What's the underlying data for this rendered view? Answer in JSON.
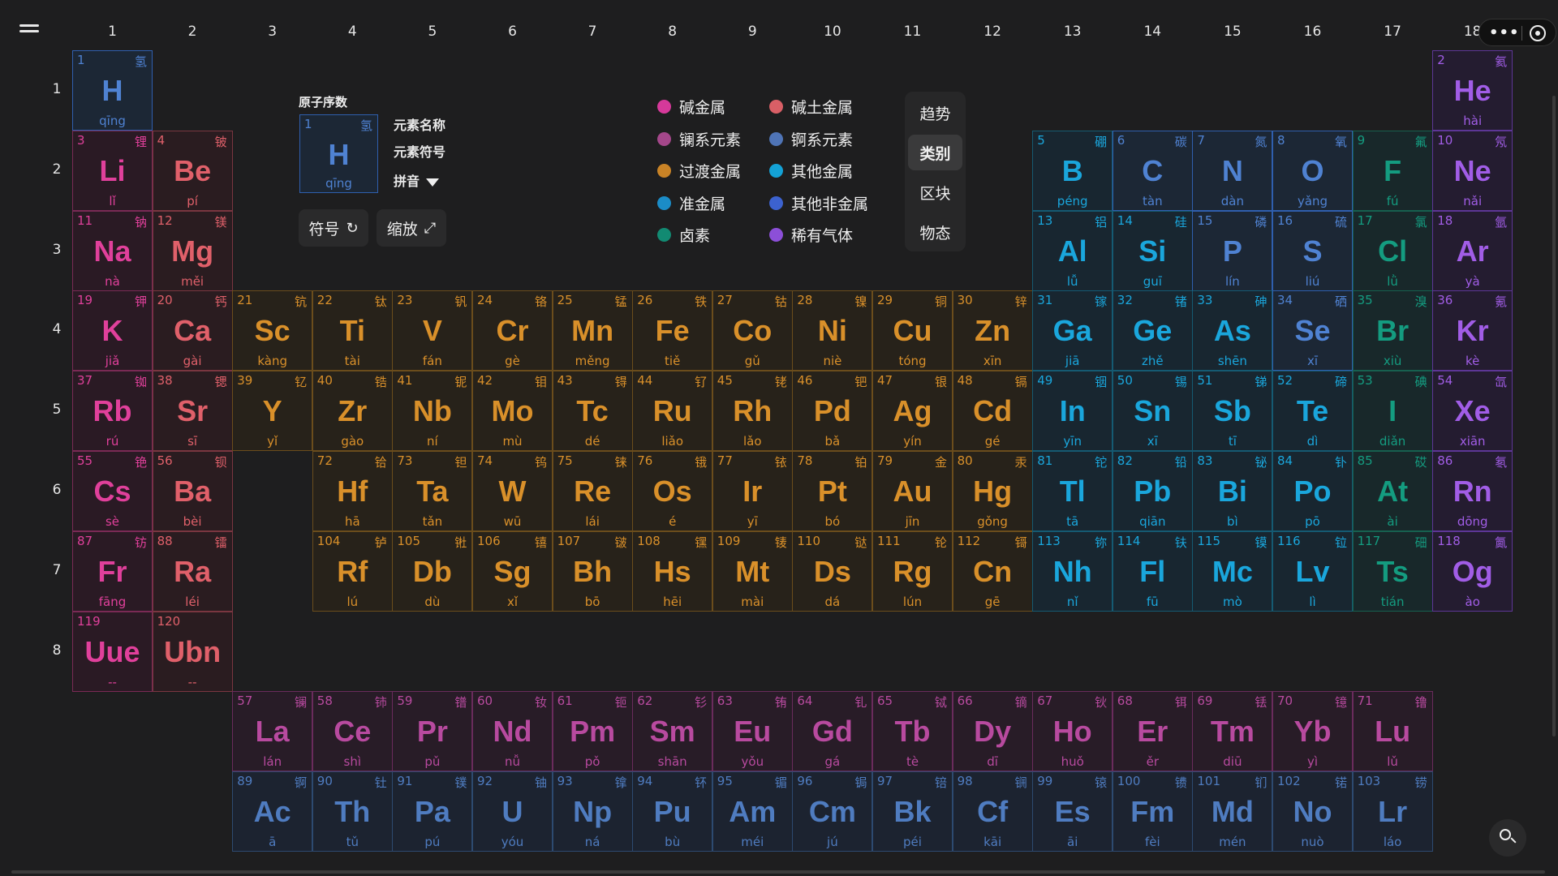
{
  "groups": [
    "1",
    "2",
    "3",
    "4",
    "5",
    "6",
    "7",
    "8",
    "9",
    "10",
    "11",
    "12",
    "13",
    "14",
    "15",
    "16",
    "17",
    "18"
  ],
  "periods": [
    "1",
    "2",
    "3",
    "4",
    "5",
    "6",
    "7",
    "8"
  ],
  "colors": {
    "alkali": {
      "border": "#7a2a55",
      "bg": "#2a1a24",
      "text": "#e0409b"
    },
    "alkaline": {
      "border": "#7a3640",
      "bg": "#2a1c20",
      "text": "#e0606a"
    },
    "transition": {
      "border": "#6b4d1c",
      "bg": "#27221a",
      "text": "#d9902a"
    },
    "post": {
      "border": "#155a72",
      "bg": "#182630",
      "text": "#1aa6dc"
    },
    "metalloid": {
      "border": "#155a72",
      "bg": "#182630",
      "text": "#1aa6dc"
    },
    "nonmetal": {
      "border": "#2f5fae",
      "bg": "#1c2735",
      "text": "#4f82d2"
    },
    "halogen": {
      "border": "#17604f",
      "bg": "#18282a",
      "text": "#149c80"
    },
    "noble": {
      "border": "#5d3696",
      "bg": "#241c30",
      "text": "#a15de6"
    },
    "lanthanide": {
      "border": "#6a2b5c",
      "bg": "#281c27",
      "text": "#b84a9f"
    },
    "actinide": {
      "border": "#2d4a70",
      "bg": "#1c2330",
      "text": "#4f7cc0"
    }
  },
  "elements": [
    {
      "n": 1,
      "sym": "H",
      "zh": "氢",
      "py": "qīng",
      "c": "nonmetal",
      "p": 1,
      "g": 1
    },
    {
      "n": 2,
      "sym": "He",
      "zh": "氦",
      "py": "hài",
      "c": "noble",
      "p": 1,
      "g": 18
    },
    {
      "n": 3,
      "sym": "Li",
      "zh": "锂",
      "py": "lǐ",
      "c": "alkali",
      "p": 2,
      "g": 1
    },
    {
      "n": 4,
      "sym": "Be",
      "zh": "铍",
      "py": "pí",
      "c": "alkaline",
      "p": 2,
      "g": 2
    },
    {
      "n": 5,
      "sym": "B",
      "zh": "硼",
      "py": "péng",
      "c": "metalloid",
      "p": 2,
      "g": 13
    },
    {
      "n": 6,
      "sym": "C",
      "zh": "碳",
      "py": "tàn",
      "c": "nonmetal",
      "p": 2,
      "g": 14
    },
    {
      "n": 7,
      "sym": "N",
      "zh": "氮",
      "py": "dàn",
      "c": "nonmetal",
      "p": 2,
      "g": 15
    },
    {
      "n": 8,
      "sym": "O",
      "zh": "氧",
      "py": "yǎng",
      "c": "nonmetal",
      "p": 2,
      "g": 16
    },
    {
      "n": 9,
      "sym": "F",
      "zh": "氟",
      "py": "fú",
      "c": "halogen",
      "p": 2,
      "g": 17
    },
    {
      "n": 10,
      "sym": "Ne",
      "zh": "氖",
      "py": "nǎi",
      "c": "noble",
      "p": 2,
      "g": 18
    },
    {
      "n": 11,
      "sym": "Na",
      "zh": "钠",
      "py": "nà",
      "c": "alkali",
      "p": 3,
      "g": 1
    },
    {
      "n": 12,
      "sym": "Mg",
      "zh": "镁",
      "py": "měi",
      "c": "alkaline",
      "p": 3,
      "g": 2
    },
    {
      "n": 13,
      "sym": "Al",
      "zh": "铝",
      "py": "lǚ",
      "c": "post",
      "p": 3,
      "g": 13
    },
    {
      "n": 14,
      "sym": "Si",
      "zh": "硅",
      "py": "guī",
      "c": "metalloid",
      "p": 3,
      "g": 14
    },
    {
      "n": 15,
      "sym": "P",
      "zh": "磷",
      "py": "lín",
      "c": "nonmetal",
      "p": 3,
      "g": 15
    },
    {
      "n": 16,
      "sym": "S",
      "zh": "硫",
      "py": "liú",
      "c": "nonmetal",
      "p": 3,
      "g": 16
    },
    {
      "n": 17,
      "sym": "Cl",
      "zh": "氯",
      "py": "lǜ",
      "c": "halogen",
      "p": 3,
      "g": 17
    },
    {
      "n": 18,
      "sym": "Ar",
      "zh": "氩",
      "py": "yà",
      "c": "noble",
      "p": 3,
      "g": 18
    },
    {
      "n": 19,
      "sym": "K",
      "zh": "钾",
      "py": "jiǎ",
      "c": "alkali",
      "p": 4,
      "g": 1
    },
    {
      "n": 20,
      "sym": "Ca",
      "zh": "钙",
      "py": "gài",
      "c": "alkaline",
      "p": 4,
      "g": 2
    },
    {
      "n": 21,
      "sym": "Sc",
      "zh": "钪",
      "py": "kàng",
      "c": "transition",
      "p": 4,
      "g": 3
    },
    {
      "n": 22,
      "sym": "Ti",
      "zh": "钛",
      "py": "tài",
      "c": "transition",
      "p": 4,
      "g": 4
    },
    {
      "n": 23,
      "sym": "V",
      "zh": "钒",
      "py": "fán",
      "c": "transition",
      "p": 4,
      "g": 5
    },
    {
      "n": 24,
      "sym": "Cr",
      "zh": "铬",
      "py": "gè",
      "c": "transition",
      "p": 4,
      "g": 6
    },
    {
      "n": 25,
      "sym": "Mn",
      "zh": "锰",
      "py": "měng",
      "c": "transition",
      "p": 4,
      "g": 7
    },
    {
      "n": 26,
      "sym": "Fe",
      "zh": "铁",
      "py": "tiě",
      "c": "transition",
      "p": 4,
      "g": 8
    },
    {
      "n": 27,
      "sym": "Co",
      "zh": "钴",
      "py": "gǔ",
      "c": "transition",
      "p": 4,
      "g": 9
    },
    {
      "n": 28,
      "sym": "Ni",
      "zh": "镍",
      "py": "niè",
      "c": "transition",
      "p": 4,
      "g": 10
    },
    {
      "n": 29,
      "sym": "Cu",
      "zh": "铜",
      "py": "tóng",
      "c": "transition",
      "p": 4,
      "g": 11
    },
    {
      "n": 30,
      "sym": "Zn",
      "zh": "锌",
      "py": "xīn",
      "c": "transition",
      "p": 4,
      "g": 12
    },
    {
      "n": 31,
      "sym": "Ga",
      "zh": "镓",
      "py": "jiā",
      "c": "post",
      "p": 4,
      "g": 13
    },
    {
      "n": 32,
      "sym": "Ge",
      "zh": "锗",
      "py": "zhě",
      "c": "metalloid",
      "p": 4,
      "g": 14
    },
    {
      "n": 33,
      "sym": "As",
      "zh": "砷",
      "py": "shēn",
      "c": "metalloid",
      "p": 4,
      "g": 15
    },
    {
      "n": 34,
      "sym": "Se",
      "zh": "硒",
      "py": "xī",
      "c": "nonmetal",
      "p": 4,
      "g": 16
    },
    {
      "n": 35,
      "sym": "Br",
      "zh": "溴",
      "py": "xiù",
      "c": "halogen",
      "p": 4,
      "g": 17
    },
    {
      "n": 36,
      "sym": "Kr",
      "zh": "氪",
      "py": "kè",
      "c": "noble",
      "p": 4,
      "g": 18
    },
    {
      "n": 37,
      "sym": "Rb",
      "zh": "铷",
      "py": "rú",
      "c": "alkali",
      "p": 5,
      "g": 1
    },
    {
      "n": 38,
      "sym": "Sr",
      "zh": "锶",
      "py": "sī",
      "c": "alkaline",
      "p": 5,
      "g": 2
    },
    {
      "n": 39,
      "sym": "Y",
      "zh": "钇",
      "py": "yǐ",
      "c": "transition",
      "p": 5,
      "g": 3
    },
    {
      "n": 40,
      "sym": "Zr",
      "zh": "锆",
      "py": "gào",
      "c": "transition",
      "p": 5,
      "g": 4
    },
    {
      "n": 41,
      "sym": "Nb",
      "zh": "铌",
      "py": "ní",
      "c": "transition",
      "p": 5,
      "g": 5
    },
    {
      "n": 42,
      "sym": "Mo",
      "zh": "钼",
      "py": "mù",
      "c": "transition",
      "p": 5,
      "g": 6
    },
    {
      "n": 43,
      "sym": "Tc",
      "zh": "锝",
      "py": "dé",
      "c": "transition",
      "p": 5,
      "g": 7
    },
    {
      "n": 44,
      "sym": "Ru",
      "zh": "钌",
      "py": "liǎo",
      "c": "transition",
      "p": 5,
      "g": 8
    },
    {
      "n": 45,
      "sym": "Rh",
      "zh": "铑",
      "py": "lǎo",
      "c": "transition",
      "p": 5,
      "g": 9
    },
    {
      "n": 46,
      "sym": "Pd",
      "zh": "钯",
      "py": "bǎ",
      "c": "transition",
      "p": 5,
      "g": 10
    },
    {
      "n": 47,
      "sym": "Ag",
      "zh": "银",
      "py": "yín",
      "c": "transition",
      "p": 5,
      "g": 11
    },
    {
      "n": 48,
      "sym": "Cd",
      "zh": "镉",
      "py": "gé",
      "c": "transition",
      "p": 5,
      "g": 12
    },
    {
      "n": 49,
      "sym": "In",
      "zh": "铟",
      "py": "yīn",
      "c": "post",
      "p": 5,
      "g": 13
    },
    {
      "n": 50,
      "sym": "Sn",
      "zh": "锡",
      "py": "xī",
      "c": "post",
      "p": 5,
      "g": 14
    },
    {
      "n": 51,
      "sym": "Sb",
      "zh": "锑",
      "py": "tī",
      "c": "metalloid",
      "p": 5,
      "g": 15
    },
    {
      "n": 52,
      "sym": "Te",
      "zh": "碲",
      "py": "dì",
      "c": "metalloid",
      "p": 5,
      "g": 16
    },
    {
      "n": 53,
      "sym": "I",
      "zh": "碘",
      "py": "diǎn",
      "c": "halogen",
      "p": 5,
      "g": 17
    },
    {
      "n": 54,
      "sym": "Xe",
      "zh": "氙",
      "py": "xiān",
      "c": "noble",
      "p": 5,
      "g": 18
    },
    {
      "n": 55,
      "sym": "Cs",
      "zh": "铯",
      "py": "sè",
      "c": "alkali",
      "p": 6,
      "g": 1
    },
    {
      "n": 56,
      "sym": "Ba",
      "zh": "钡",
      "py": "bèi",
      "c": "alkaline",
      "p": 6,
      "g": 2
    },
    {
      "n": 72,
      "sym": "Hf",
      "zh": "铪",
      "py": "hā",
      "c": "transition",
      "p": 6,
      "g": 4
    },
    {
      "n": 73,
      "sym": "Ta",
      "zh": "钽",
      "py": "tǎn",
      "c": "transition",
      "p": 6,
      "g": 5
    },
    {
      "n": 74,
      "sym": "W",
      "zh": "钨",
      "py": "wū",
      "c": "transition",
      "p": 6,
      "g": 6
    },
    {
      "n": 75,
      "sym": "Re",
      "zh": "铼",
      "py": "lái",
      "c": "transition",
      "p": 6,
      "g": 7
    },
    {
      "n": 76,
      "sym": "Os",
      "zh": "锇",
      "py": "é",
      "c": "transition",
      "p": 6,
      "g": 8
    },
    {
      "n": 77,
      "sym": "Ir",
      "zh": "铱",
      "py": "yī",
      "c": "transition",
      "p": 6,
      "g": 9
    },
    {
      "n": 78,
      "sym": "Pt",
      "zh": "铂",
      "py": "bó",
      "c": "transition",
      "p": 6,
      "g": 10
    },
    {
      "n": 79,
      "sym": "Au",
      "zh": "金",
      "py": "jīn",
      "c": "transition",
      "p": 6,
      "g": 11
    },
    {
      "n": 80,
      "sym": "Hg",
      "zh": "汞",
      "py": "gǒng",
      "c": "transition",
      "p": 6,
      "g": 12
    },
    {
      "n": 81,
      "sym": "Tl",
      "zh": "铊",
      "py": "tā",
      "c": "post",
      "p": 6,
      "g": 13
    },
    {
      "n": 82,
      "sym": "Pb",
      "zh": "铅",
      "py": "qiān",
      "c": "post",
      "p": 6,
      "g": 14
    },
    {
      "n": 83,
      "sym": "Bi",
      "zh": "铋",
      "py": "bì",
      "c": "post",
      "p": 6,
      "g": 15
    },
    {
      "n": 84,
      "sym": "Po",
      "zh": "钋",
      "py": "pō",
      "c": "post",
      "p": 6,
      "g": 16
    },
    {
      "n": 85,
      "sym": "At",
      "zh": "砹",
      "py": "ài",
      "c": "halogen",
      "p": 6,
      "g": 17
    },
    {
      "n": 86,
      "sym": "Rn",
      "zh": "氡",
      "py": "dōng",
      "c": "noble",
      "p": 6,
      "g": 18
    },
    {
      "n": 87,
      "sym": "Fr",
      "zh": "钫",
      "py": "fāng",
      "c": "alkali",
      "p": 7,
      "g": 1
    },
    {
      "n": 88,
      "sym": "Ra",
      "zh": "镭",
      "py": "léi",
      "c": "alkaline",
      "p": 7,
      "g": 2
    },
    {
      "n": 104,
      "sym": "Rf",
      "zh": "𬬻",
      "py": "lú",
      "c": "transition",
      "p": 7,
      "g": 4
    },
    {
      "n": 105,
      "sym": "Db",
      "zh": "𬭊",
      "py": "dù",
      "c": "transition",
      "p": 7,
      "g": 5
    },
    {
      "n": 106,
      "sym": "Sg",
      "zh": "𬭳",
      "py": "xǐ",
      "c": "transition",
      "p": 7,
      "g": 6
    },
    {
      "n": 107,
      "sym": "Bh",
      "zh": "𬭛",
      "py": "bō",
      "c": "transition",
      "p": 7,
      "g": 7
    },
    {
      "n": 108,
      "sym": "Hs",
      "zh": "𬭶",
      "py": "hēi",
      "c": "transition",
      "p": 7,
      "g": 8
    },
    {
      "n": 109,
      "sym": "Mt",
      "zh": "鿏",
      "py": "mài",
      "c": "transition",
      "p": 7,
      "g": 9
    },
    {
      "n": 110,
      "sym": "Ds",
      "zh": "𫟼",
      "py": "dá",
      "c": "transition",
      "p": 7,
      "g": 10
    },
    {
      "n": 111,
      "sym": "Rg",
      "zh": "𬬭",
      "py": "lún",
      "c": "transition",
      "p": 7,
      "g": 11
    },
    {
      "n": 112,
      "sym": "Cn",
      "zh": "鿔",
      "py": "gē",
      "c": "transition",
      "p": 7,
      "g": 12
    },
    {
      "n": 113,
      "sym": "Nh",
      "zh": "鿭",
      "py": "nǐ",
      "c": "post",
      "p": 7,
      "g": 13
    },
    {
      "n": 114,
      "sym": "Fl",
      "zh": "𫓧",
      "py": "fū",
      "c": "post",
      "p": 7,
      "g": 14
    },
    {
      "n": 115,
      "sym": "Mc",
      "zh": "镆",
      "py": "mò",
      "c": "post",
      "p": 7,
      "g": 15
    },
    {
      "n": 116,
      "sym": "Lv",
      "zh": "𫟷",
      "py": "lì",
      "c": "post",
      "p": 7,
      "g": 16
    },
    {
      "n": 117,
      "sym": "Ts",
      "zh": "鿬",
      "py": "tián",
      "c": "halogen",
      "p": 7,
      "g": 17
    },
    {
      "n": 118,
      "sym": "Og",
      "zh": "鿫",
      "py": "ào",
      "c": "noble",
      "p": 7,
      "g": 18
    },
    {
      "n": 119,
      "sym": "Uue",
      "zh": "",
      "py": "--",
      "c": "alkali",
      "p": 8,
      "g": 1
    },
    {
      "n": 120,
      "sym": "Ubn",
      "zh": "",
      "py": "--",
      "c": "alkaline",
      "p": 8,
      "g": 2
    },
    {
      "n": 57,
      "sym": "La",
      "zh": "镧",
      "py": "lán",
      "c": "lanthanide",
      "p": 9,
      "g": 3
    },
    {
      "n": 58,
      "sym": "Ce",
      "zh": "铈",
      "py": "shì",
      "c": "lanthanide",
      "p": 9,
      "g": 4
    },
    {
      "n": 59,
      "sym": "Pr",
      "zh": "镨",
      "py": "pǔ",
      "c": "lanthanide",
      "p": 9,
      "g": 5
    },
    {
      "n": 60,
      "sym": "Nd",
      "zh": "钕",
      "py": "nǚ",
      "c": "lanthanide",
      "p": 9,
      "g": 6
    },
    {
      "n": 61,
      "sym": "Pm",
      "zh": "钷",
      "py": "pǒ",
      "c": "lanthanide",
      "p": 9,
      "g": 7
    },
    {
      "n": 62,
      "sym": "Sm",
      "zh": "钐",
      "py": "shān",
      "c": "lanthanide",
      "p": 9,
      "g": 8
    },
    {
      "n": 63,
      "sym": "Eu",
      "zh": "铕",
      "py": "yǒu",
      "c": "lanthanide",
      "p": 9,
      "g": 9
    },
    {
      "n": 64,
      "sym": "Gd",
      "zh": "钆",
      "py": "gá",
      "c": "lanthanide",
      "p": 9,
      "g": 10
    },
    {
      "n": 65,
      "sym": "Tb",
      "zh": "铽",
      "py": "tè",
      "c": "lanthanide",
      "p": 9,
      "g": 11
    },
    {
      "n": 66,
      "sym": "Dy",
      "zh": "镝",
      "py": "dī",
      "c": "lanthanide",
      "p": 9,
      "g": 12
    },
    {
      "n": 67,
      "sym": "Ho",
      "zh": "钬",
      "py": "huǒ",
      "c": "lanthanide",
      "p": 9,
      "g": 13
    },
    {
      "n": 68,
      "sym": "Er",
      "zh": "铒",
      "py": "ěr",
      "c": "lanthanide",
      "p": 9,
      "g": 14
    },
    {
      "n": 69,
      "sym": "Tm",
      "zh": "铥",
      "py": "diū",
      "c": "lanthanide",
      "p": 9,
      "g": 15
    },
    {
      "n": 70,
      "sym": "Yb",
      "zh": "镱",
      "py": "yì",
      "c": "lanthanide",
      "p": 9,
      "g": 16
    },
    {
      "n": 71,
      "sym": "Lu",
      "zh": "镥",
      "py": "lǔ",
      "c": "lanthanide",
      "p": 9,
      "g": 17
    },
    {
      "n": 89,
      "sym": "Ac",
      "zh": "锕",
      "py": "ā",
      "c": "actinide",
      "p": 10,
      "g": 3
    },
    {
      "n": 90,
      "sym": "Th",
      "zh": "钍",
      "py": "tǔ",
      "c": "actinide",
      "p": 10,
      "g": 4
    },
    {
      "n": 91,
      "sym": "Pa",
      "zh": "镤",
      "py": "pú",
      "c": "actinide",
      "p": 10,
      "g": 5
    },
    {
      "n": 92,
      "sym": "U",
      "zh": "铀",
      "py": "yóu",
      "c": "actinide",
      "p": 10,
      "g": 6
    },
    {
      "n": 93,
      "sym": "Np",
      "zh": "镎",
      "py": "ná",
      "c": "actinide",
      "p": 10,
      "g": 7
    },
    {
      "n": 94,
      "sym": "Pu",
      "zh": "钚",
      "py": "bù",
      "c": "actinide",
      "p": 10,
      "g": 8
    },
    {
      "n": 95,
      "sym": "Am",
      "zh": "镅",
      "py": "méi",
      "c": "actinide",
      "p": 10,
      "g": 9
    },
    {
      "n": 96,
      "sym": "Cm",
      "zh": "锔",
      "py": "jú",
      "c": "actinide",
      "p": 10,
      "g": 10
    },
    {
      "n": 97,
      "sym": "Bk",
      "zh": "锫",
      "py": "péi",
      "c": "actinide",
      "p": 10,
      "g": 11
    },
    {
      "n": 98,
      "sym": "Cf",
      "zh": "锎",
      "py": "kāi",
      "c": "actinide",
      "p": 10,
      "g": 12
    },
    {
      "n": 99,
      "sym": "Es",
      "zh": "锿",
      "py": "āi",
      "c": "actinide",
      "p": 10,
      "g": 13
    },
    {
      "n": 100,
      "sym": "Fm",
      "zh": "镄",
      "py": "fèi",
      "c": "actinide",
      "p": 10,
      "g": 14
    },
    {
      "n": 101,
      "sym": "Md",
      "zh": "钔",
      "py": "mén",
      "c": "actinide",
      "p": 10,
      "g": 15
    },
    {
      "n": 102,
      "sym": "No",
      "zh": "锘",
      "py": "nuò",
      "c": "actinide",
      "p": 10,
      "g": 16
    },
    {
      "n": 103,
      "sym": "Lr",
      "zh": "铹",
      "py": "láo",
      "c": "actinide",
      "p": 10,
      "g": 17
    }
  ],
  "info": {
    "title": "原子序数",
    "name_label": "元素名称",
    "symbol_label": "元素符号",
    "pinyin_label": "拼音",
    "sample_num": "1",
    "sample_zh": "氢",
    "sample_sym": "H",
    "sample_py": "qīng"
  },
  "controls": {
    "symbol": "符号",
    "zoom": "缩放"
  },
  "legend": [
    {
      "label": "碱金属",
      "color": "#d6399a"
    },
    {
      "label": "碱土金属",
      "color": "#d95f66"
    },
    {
      "label": "镧系元素",
      "color": "#a4478a"
    },
    {
      "label": "锕系元素",
      "color": "#4f74b6"
    },
    {
      "label": "过渡金属",
      "color": "#c98326"
    },
    {
      "label": "其他金属",
      "color": "#14a2d6"
    },
    {
      "label": "准金属",
      "color": "#1b8cc7"
    },
    {
      "label": "其他非金属",
      "color": "#3c62cf"
    },
    {
      "label": "卤素",
      "color": "#128a72"
    },
    {
      "label": "稀有气体",
      "color": "#8c4fd8"
    }
  ],
  "modes": [
    {
      "label": "趋势"
    },
    {
      "label": "类别"
    },
    {
      "label": "区块"
    },
    {
      "label": "物态"
    }
  ],
  "active_mode": "类别"
}
